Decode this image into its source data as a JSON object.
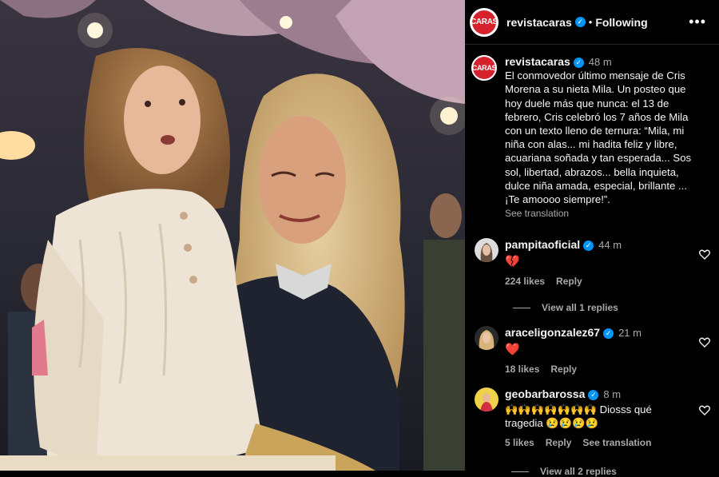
{
  "post": {
    "username": "revistacaras",
    "following_label": "Following",
    "separator": "•",
    "more": "•••",
    "avatar_text": "CARAS",
    "brand_color": "#d5222c",
    "caption_lines": [
      "El conmovedor último mensaje de Cris",
      "Morena a su nieta Mila. Un posteo que",
      "hoy duele más que nunca: el 13 de",
      "febrero, Cris celebró los 7 años de Mila",
      "con un texto lleno de ternura: “Mila, mi",
      "niña con alas... mi hadita feliz y libre,",
      "acuariana soñada y tan esperada... Sos",
      "sol, libertad, abrazos... bella inquieta,",
      "dulce niña amada, especial, brillante ...",
      "¡Te amoooo siempre!”."
    ],
    "time": "48 m",
    "see_translation": "See translation"
  },
  "comments": [
    {
      "username": "pampitaoficial",
      "time": "44 m",
      "text": "💔",
      "likes": "224 likes",
      "reply": "Reply",
      "view_replies": "View all 1 replies"
    },
    {
      "username": "araceligonzalez67",
      "time": "21 m",
      "text": "❤️",
      "likes": "18 likes",
      "reply": "Reply"
    },
    {
      "username": "geobarbarossa",
      "time": "8 m",
      "text_line1": "🙌🙌🙌🙌🙌🙌🙌 Diosss qué",
      "text_line2": "tragedia 😢😢😢😢",
      "likes": "5 likes",
      "reply": "Reply",
      "see_translation": "See translation",
      "view_replies": "View all 2 replies"
    }
  ],
  "colors": {
    "background": "#000000",
    "text": "#f5f5f5",
    "secondary": "#a8a8a8",
    "verified": "#0095f6",
    "heart": "#ed2d3a"
  }
}
